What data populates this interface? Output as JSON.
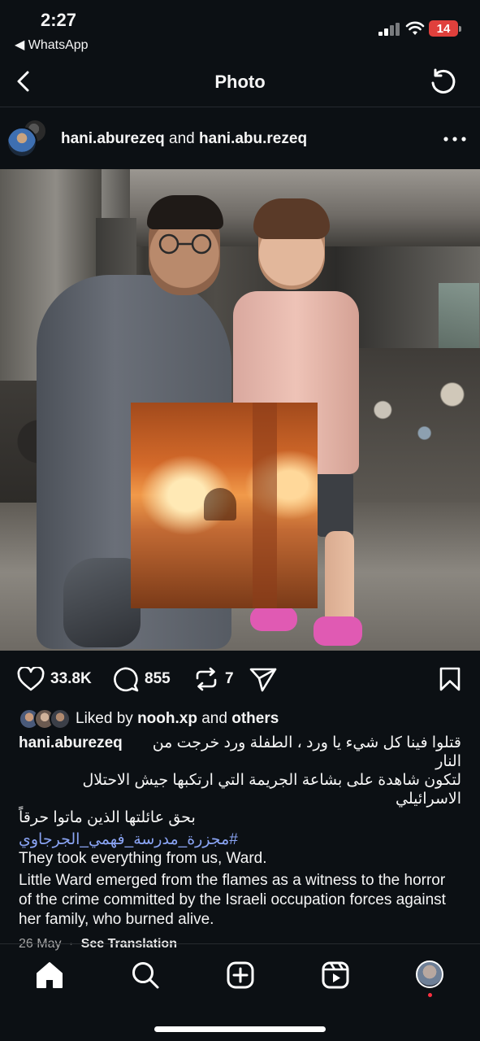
{
  "status_bar": {
    "time": "2:27",
    "back_app": "◀ WhatsApp",
    "battery": "14"
  },
  "header": {
    "title": "Photo"
  },
  "post": {
    "author_1": "hani.aburezeq",
    "joiner": "and",
    "author_2": "hani.abu.rezeq",
    "stats": {
      "likes": "33.8K",
      "comments": "855",
      "reposts": "7"
    },
    "liked_by_prefix": "Liked by",
    "liked_by_user": "nooh.xp",
    "liked_by_and": "and",
    "liked_by_others": "others",
    "caption_author": "hani.aburezeq",
    "caption_ar_line1": "قتلوا فينا كل شيء يا ورد ، الطفلة ورد خرجت من النار",
    "caption_ar_line2": "لتكون شاهدة على بشاعة الجريمة التي ارتكبها جيش الاحتلال الاسرائيلي",
    "caption_ar_line3": "بحق عائلتها  الذين ماتوا حرقاً",
    "hashtag": "#مجزرة_مدرسة_فهمي_الجرجاوي",
    "caption_en_1": "They took everything from us, Ward.",
    "caption_en_2": "Little Ward emerged from the flames as a witness to the horror of the crime committed by the Israeli occupation forces against her family, who burned alive.",
    "date": "26 May",
    "separator": "·",
    "see_translation": "See Translation"
  },
  "colors": {
    "background": "#0c1014",
    "hashtag": "#8aa4f4",
    "notification_dot": "#ff3040",
    "battery": "#e0403c"
  },
  "icons": [
    "chevron-left-icon",
    "refresh-icon",
    "more-icon",
    "heart-icon",
    "comment-icon",
    "repost-icon",
    "share-icon",
    "bookmark-icon",
    "home-icon",
    "search-icon",
    "create-icon",
    "reels-icon"
  ]
}
